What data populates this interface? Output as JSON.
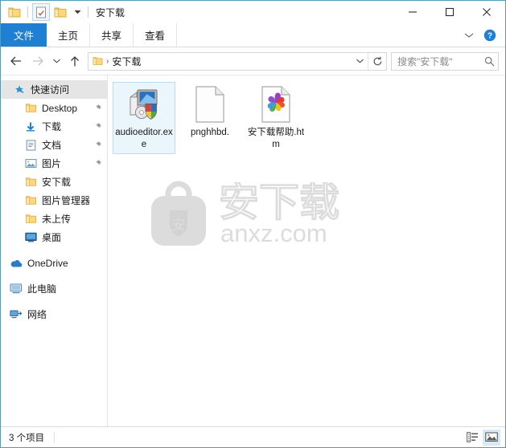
{
  "window": {
    "title": "安下载",
    "border_color": "#4c9fbb",
    "quick_access": [
      {
        "name": "folder-icon",
        "label": "文件夹",
        "active": false
      },
      {
        "name": "properties-icon",
        "label": "属性",
        "active": true
      },
      {
        "name": "new-folder-icon",
        "label": "新建文件夹",
        "active": false
      }
    ],
    "controls": {
      "minimize": "最小化",
      "maximize": "最大化",
      "close": "关闭"
    }
  },
  "ribbon": {
    "tabs": [
      {
        "label": "文件",
        "active": true
      },
      {
        "label": "主页",
        "active": false
      },
      {
        "label": "共享",
        "active": false
      },
      {
        "label": "查看",
        "active": false
      }
    ],
    "expand_label": "展开功能区",
    "help_label": "帮助",
    "accent_color": "#1f7fd0"
  },
  "address": {
    "back_label": "后退",
    "forward_label": "前进",
    "recent_label": "最近浏览的位置",
    "up_label": "上移一级",
    "breadcrumb": [
      "安下载"
    ],
    "dropdown_label": "以前的位置",
    "refresh_label": "刷新"
  },
  "search": {
    "placeholder": "搜索\"安下载\"",
    "value": ""
  },
  "sidebar": {
    "items": [
      {
        "label": "快速访问",
        "icon": "pin-star-icon",
        "level": "root",
        "selected": true,
        "pinned": false
      },
      {
        "label": "Desktop",
        "icon": "folder-icon",
        "level": "1",
        "selected": false,
        "pinned": true
      },
      {
        "label": "下载",
        "icon": "download-icon",
        "level": "1",
        "selected": false,
        "pinned": true
      },
      {
        "label": "文档",
        "icon": "documents-icon",
        "level": "1",
        "selected": false,
        "pinned": true
      },
      {
        "label": "图片",
        "icon": "pictures-icon",
        "level": "1",
        "selected": false,
        "pinned": true
      },
      {
        "label": "安下载",
        "icon": "folder-icon",
        "level": "1",
        "selected": false,
        "pinned": false
      },
      {
        "label": "图片管理器",
        "icon": "folder-icon",
        "level": "1",
        "selected": false,
        "pinned": false
      },
      {
        "label": "未上传",
        "icon": "folder-icon",
        "level": "1",
        "selected": false,
        "pinned": false
      },
      {
        "label": "桌面",
        "icon": "desktop-icon",
        "level": "1",
        "selected": false,
        "pinned": false
      },
      {
        "label": "OneDrive",
        "icon": "onedrive-icon",
        "level": "0",
        "selected": false,
        "pinned": false,
        "gap_before": true
      },
      {
        "label": "此电脑",
        "icon": "this-pc-icon",
        "level": "0",
        "selected": false,
        "pinned": false,
        "gap_before": true
      },
      {
        "label": "网络",
        "icon": "network-icon",
        "level": "0",
        "selected": false,
        "pinned": false,
        "gap_before": true
      }
    ]
  },
  "files": [
    {
      "name": "audioeditor.exe",
      "icon": "application-exe-icon",
      "selected": true
    },
    {
      "name": "pnghhbd.",
      "icon": "blank-document-icon",
      "selected": false
    },
    {
      "name": "安下载帮助.htm",
      "icon": "html-document-icon",
      "selected": false
    }
  ],
  "watermark": {
    "brand": "安下载",
    "shield_char": "安",
    "url": "anxz.com",
    "color": "#dcdcdc"
  },
  "status": {
    "item_count": "3 个项目",
    "views": [
      {
        "label": "详细信息",
        "icon": "details-view-icon",
        "active": false
      },
      {
        "label": "大图标",
        "icon": "large-icons-view-icon",
        "active": true
      }
    ]
  }
}
